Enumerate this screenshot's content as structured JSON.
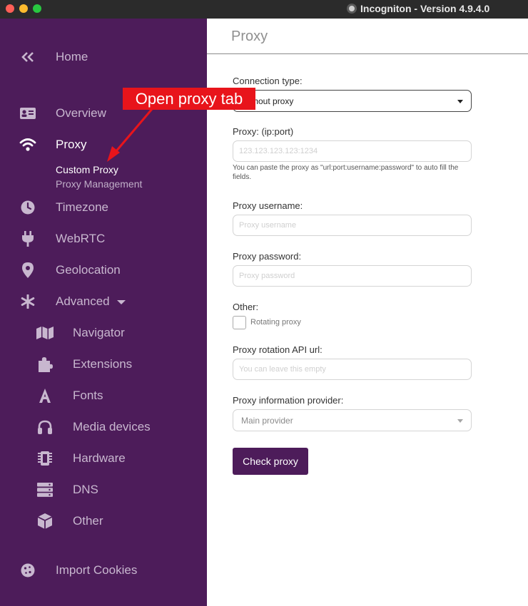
{
  "window": {
    "title": "Incogniton - Version 4.9.4.0"
  },
  "annotation": {
    "text": "Open proxy tab"
  },
  "sidebar": {
    "home": "Home",
    "overview": "Overview",
    "proxy": "Proxy",
    "proxy_subitems": [
      "Custom Proxy",
      "Proxy Management"
    ],
    "timezone": "Timezone",
    "webrtc": "WebRTC",
    "geolocation": "Geolocation",
    "advanced": "Advanced",
    "advanced_items": [
      "Navigator",
      "Extensions",
      "Fonts",
      "Media devices",
      "Hardware",
      "DNS",
      "Other"
    ],
    "import_cookies": "Import Cookies"
  },
  "main": {
    "title": "Proxy",
    "connection_type": {
      "label": "Connection type:",
      "value": "Without proxy"
    },
    "proxy_address": {
      "label": "Proxy: (ip:port)",
      "placeholder": "123.123.123.123:1234",
      "help": "You can paste the proxy as \"url:port:username:password\" to auto fill the fields."
    },
    "proxy_username": {
      "label": "Proxy username:",
      "placeholder": "Proxy username"
    },
    "proxy_password": {
      "label": "Proxy password:",
      "placeholder": "Proxy password"
    },
    "other": {
      "label": "Other:",
      "rotating_label": "Rotating proxy",
      "rotating_checked": false
    },
    "rotation_api": {
      "label": "Proxy rotation API url:",
      "placeholder": "You can leave this empty"
    },
    "info_provider": {
      "label": "Proxy information provider:",
      "value": "Main provider"
    },
    "check_button": "Check proxy"
  },
  "colors": {
    "sidebar_bg": "#4d1c5a",
    "accent_button": "#4d1c5a",
    "annotation_red": "#e8141b"
  }
}
